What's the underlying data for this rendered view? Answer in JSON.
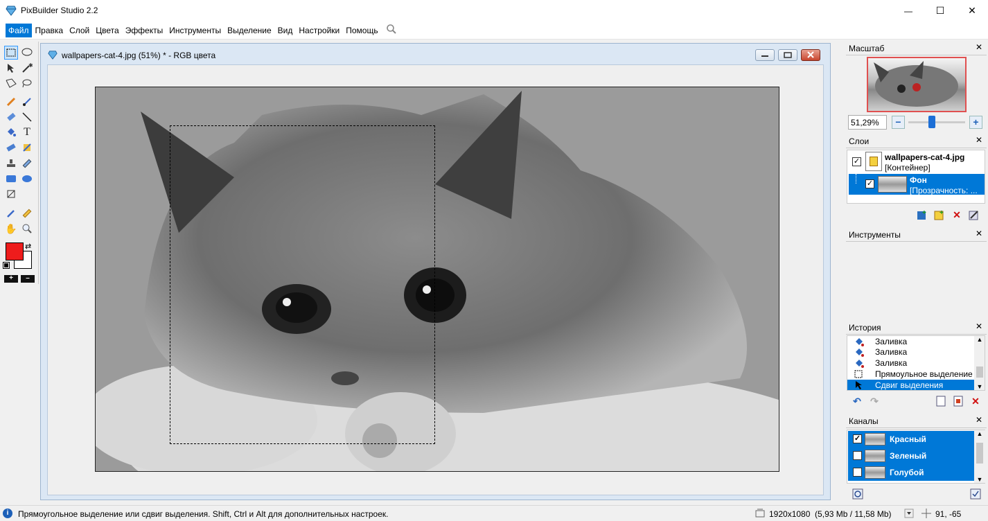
{
  "app": {
    "title": "PixBuilder Studio 2.2"
  },
  "window_controls": {
    "minimize": "—",
    "maximize": "☐",
    "close": "✕"
  },
  "menu": [
    "Файл",
    "Правка",
    "Слой",
    "Цвета",
    "Эффекты",
    "Инструменты",
    "Выделение",
    "Вид",
    "Настройки",
    "Помощь"
  ],
  "document": {
    "title": "wallpapers-cat-4.jpg (51%) * - RGB цвета"
  },
  "colors": {
    "foreground": "#ee1c1c",
    "background": "#ffffff",
    "accent": "#0078d7"
  },
  "panels": {
    "navigator": {
      "title": "Масштаб",
      "zoom_value": "51,29%",
      "zoom_fraction": 0.42
    },
    "layers": {
      "title": "Слои",
      "items": [
        {
          "name": "wallpapers-cat-4.jpg",
          "sub": "[Контейнер]",
          "checked": true
        },
        {
          "name": "Фон",
          "sub": "[Прозрачность: ...",
          "checked": true
        }
      ]
    },
    "tools": {
      "title": "Инструменты"
    },
    "history": {
      "title": "История",
      "items": [
        "Заливка",
        "Заливка",
        "Заливка",
        "Прямоульное выделение",
        "Сдвиг выделения"
      ]
    },
    "channels": {
      "title": "Каналы",
      "items": [
        {
          "name": "Красный",
          "checked": true
        },
        {
          "name": "Зеленый",
          "checked": false
        },
        {
          "name": "Голубой",
          "checked": false
        }
      ]
    }
  },
  "status": {
    "hint": "Прямоугольное выделение или сдвиг выделения. Shift, Ctrl и Alt для дополнительных настроек.",
    "image_info": "1920x1080  (5,93 Mb / 11,58 Mb)",
    "coords": "91, -65"
  }
}
